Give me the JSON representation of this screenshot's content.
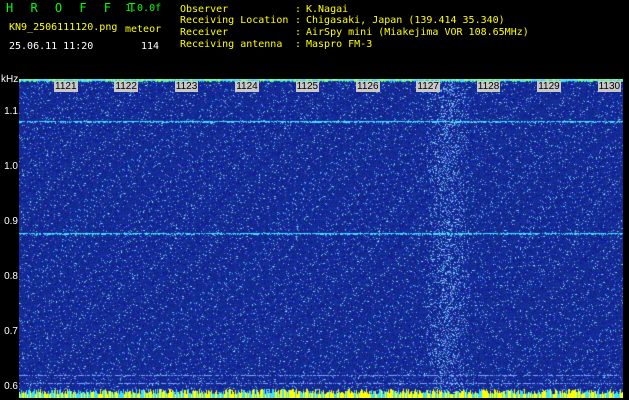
{
  "header": {
    "app_title": "H R O F F T",
    "version": "1.0.0f",
    "filename": "KN9_2506111120.png",
    "datetime": "25.06.11 11:20",
    "meteor_label": "meteor",
    "meteor_count": "114",
    "fields": [
      {
        "label": "Observer",
        "sep": ":",
        "value": "K.Nagai"
      },
      {
        "label": "Receiving Location",
        "sep": ":",
        "value": "Chigasaki, Japan (139.414 35.340)"
      },
      {
        "label": "Receiver",
        "sep": ":",
        "value": "AirSpy mini (Miakejima VOR 108.65MHz)"
      },
      {
        "label": "Receiving antenna",
        "sep": ":",
        "value": "Maspro FM-3"
      }
    ]
  },
  "chart_data": {
    "type": "heatmap",
    "y_unit": "kHz",
    "y_ticks": [
      "1.1",
      "1.0",
      "0.9",
      "0.8",
      "0.7",
      "0.6"
    ],
    "y_values": [
      1.1,
      1.0,
      0.9,
      0.8,
      0.7,
      0.6
    ],
    "ylim": [
      0.58,
      1.16
    ],
    "x_ticks": [
      "1121",
      "1122",
      "1123",
      "1124",
      "1125",
      "1126",
      "1127",
      "1128",
      "1129",
      "1130"
    ],
    "carrier_lines_khz": [
      1.083,
      0.88,
      0.621,
      0.607
    ],
    "meteor_band_center": "1127",
    "colors": {
      "background": "#0a1a8c",
      "noise": "#2a40d0",
      "line": "#40e0ff",
      "burst": "#ffff00"
    }
  }
}
